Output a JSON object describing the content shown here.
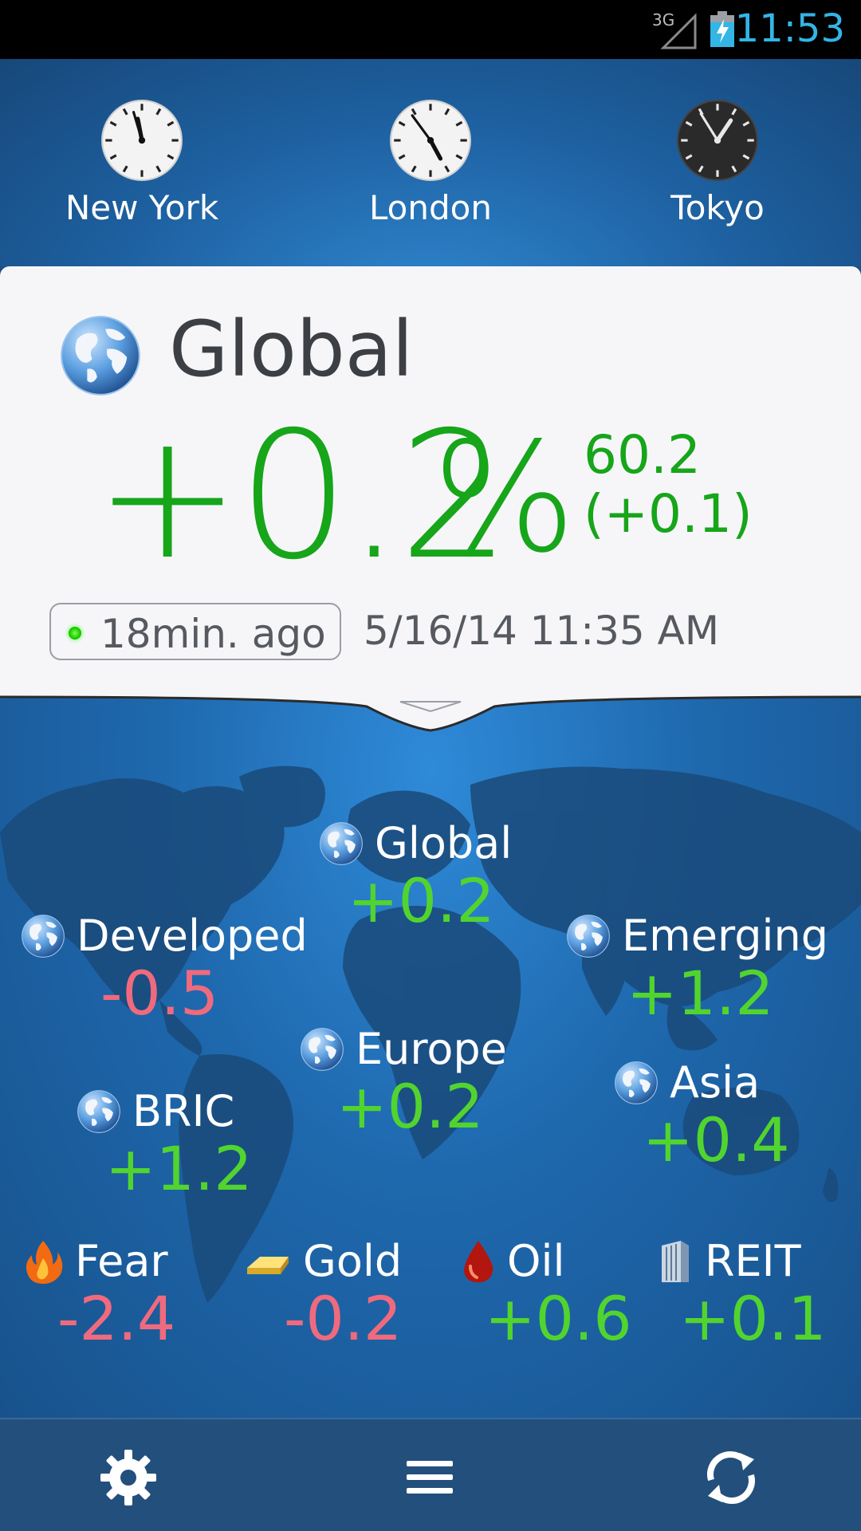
{
  "status_bar": {
    "network": "3G",
    "time": "11:53"
  },
  "clocks": [
    {
      "city": "New York",
      "theme": "light"
    },
    {
      "city": "London",
      "theme": "light"
    },
    {
      "city": "Tokyo",
      "theme": "dark"
    }
  ],
  "summary": {
    "title": "Global",
    "change_percent": "+0.2",
    "percent_sign": "%",
    "value": "60.2",
    "value_change": "(+0.1)",
    "freshness": "18min. ago",
    "timestamp": "5/16/14 11:35 AM"
  },
  "indices": {
    "global": {
      "name": "Global",
      "change": "+0.2"
    },
    "developed": {
      "name": "Developed",
      "change": "-0.5"
    },
    "emerging": {
      "name": "Emerging",
      "change": "+1.2"
    },
    "europe": {
      "name": "Europe",
      "change": "+0.2"
    },
    "asia": {
      "name": "Asia",
      "change": "+0.4"
    },
    "bric": {
      "name": "BRIC",
      "change": "+1.2"
    }
  },
  "commodities": {
    "fear": {
      "name": "Fear",
      "change": "-2.4",
      "icon": "flame-icon"
    },
    "gold": {
      "name": "Gold",
      "change": "-0.2",
      "icon": "gold-bar-icon"
    },
    "oil": {
      "name": "Oil",
      "change": "+0.6",
      "icon": "oil-drop-icon"
    },
    "reit": {
      "name": "REIT",
      "change": "+0.1",
      "icon": "building-icon"
    }
  },
  "bottom_bar": {
    "icons": [
      "gear-icon",
      "menu-icon",
      "refresh-icon"
    ]
  },
  "colors": {
    "positive": "#52d42f",
    "negative": "#f06a7e",
    "card_positive": "#17a51a",
    "accent": "#33b5e5"
  }
}
